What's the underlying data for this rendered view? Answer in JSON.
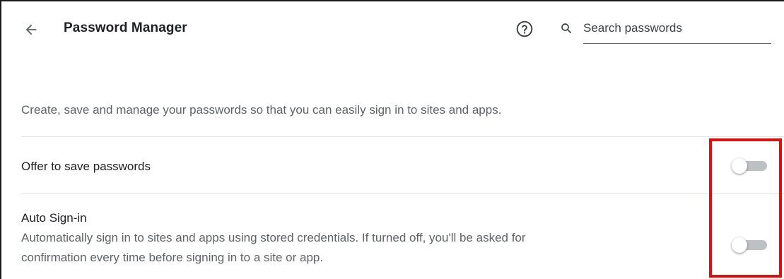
{
  "header": {
    "title": "Password Manager",
    "back_icon": "arrow-back-icon",
    "help_icon": "help-circle-icon",
    "search": {
      "icon": "search-icon",
      "placeholder": "Search passwords",
      "value": ""
    }
  },
  "description": "Create, save and manage your passwords so that you can easily sign in to sites and apps.",
  "settings": [
    {
      "label": "Offer to save passwords",
      "enabled": false
    },
    {
      "label": "Auto Sign-in",
      "sublabel_line1": "Automatically sign in to sites and apps using stored credentials. If turned off, you'll be asked for",
      "sublabel_line2": "confirmation every time before signing in to a site or app.",
      "enabled": false
    }
  ],
  "colors": {
    "highlight": "#e10e0e",
    "toggle_track_off": "#bdc1c6",
    "secondary_text": "#5f6368"
  }
}
